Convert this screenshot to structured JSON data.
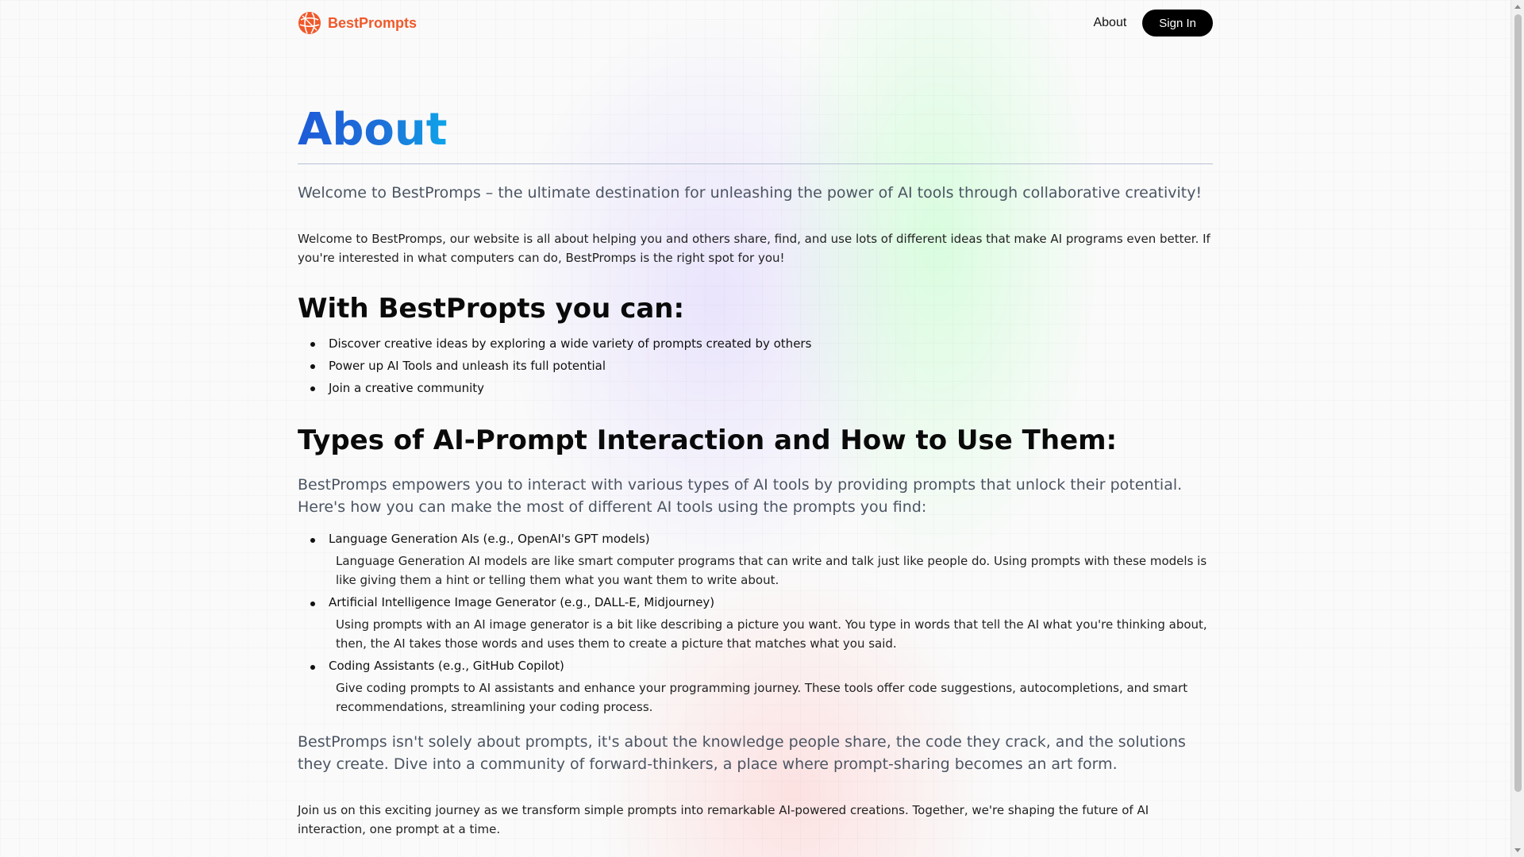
{
  "header": {
    "brand": "BestPrompts",
    "nav_about": "About",
    "sign_in": "Sign In"
  },
  "page": {
    "title": "About",
    "lead": "Welcome to BestPromps – the ultimate destination for unleashing the power of AI tools through collaborative creativity!",
    "intro": "Welcome to BestPromps, our website is all about helping you and others share, find, and use lots of different ideas that make AI programs even better. If you're interested in what computers can do, BestPromps is the right spot for you!",
    "features_heading": "With BestPropts you can:",
    "features": [
      "Discover creative ideas by exploring a wide variety of prompts created by others",
      "Power up AI Tools and unleash its full potential",
      "Join a creative community"
    ],
    "types_heading": "Types of AI-Prompt Interaction and How to Use Them:",
    "types_lead": "BestPromps empowers you to interact with various types of AI tools by providing prompts that unlock their potential. Here's how you can make the most of different AI tools using the prompts you find:",
    "types": [
      {
        "title": "Language Generation AIs (e.g., OpenAI's GPT models)",
        "desc": "Language Generation AI models are like smart computer programs that can write and talk just like people do. Using prompts with these models is like giving them a hint or telling them what you want them to write about."
      },
      {
        "title": "Artificial Intelligence Image Generator (e.g., DALL-E, Midjourney)",
        "desc": "Using prompts with an AI image generator is a bit like describing a picture you want. You type in words that tell the AI what you're thinking about, then, the AI takes those words and uses them to create a picture that matches what you said."
      },
      {
        "title": "Coding Assistants (e.g., GitHub Copilot)",
        "desc": "Give coding prompts to AI assistants and enhance your programming journey. These tools offer code suggestions, autocompletions, and smart recommendations, streamlining your coding process."
      }
    ],
    "closing_lead": "BestPromps isn't solely about prompts, it's about the knowledge people share, the code they crack, and the solutions they create. Dive into a community of forward-thinkers, a place where prompt-sharing becomes an art form.",
    "closing": "Join us on this exciting journey as we transform simple prompts into remarkable AI-powered creations. Together, we're shaping the future of AI interaction, one prompt at a time."
  },
  "colors": {
    "brand": "#f0592a",
    "title_gradient_start": "#1d5bd8",
    "title_gradient_end": "#0ea5e9",
    "button_bg": "#000000"
  },
  "icons": {
    "logo": "globe-logo-icon"
  }
}
